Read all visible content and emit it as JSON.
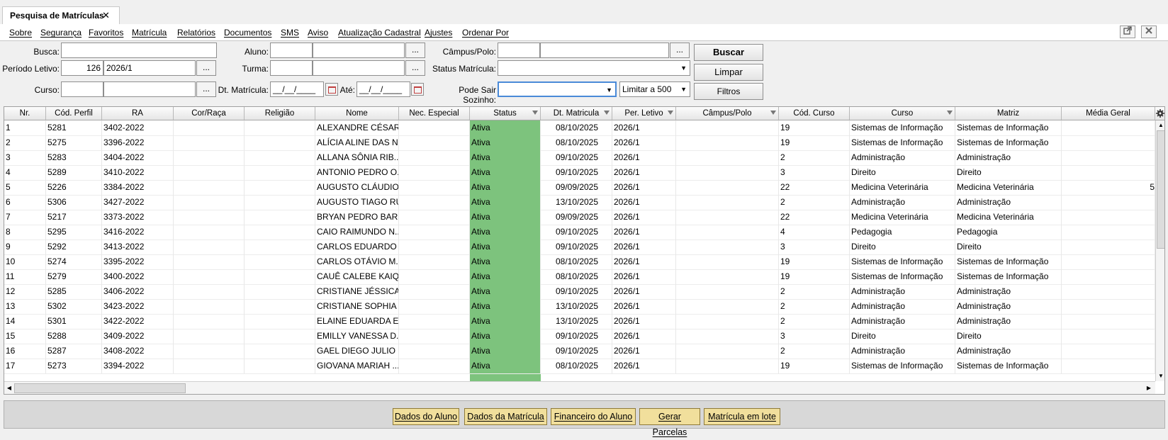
{
  "tab": {
    "title": "Pesquisa de Matrículas",
    "close": "✕"
  },
  "menu": [
    "Sobre",
    "Segurança",
    "Favoritos",
    "Matrícula",
    "Relatórios",
    "Documentos",
    "SMS",
    "Aviso",
    "Atualização Cadastral",
    "Ajustes",
    "Ordenar Por"
  ],
  "window_buttons": {
    "popout_icon": "popout-icon",
    "close_icon": "close-icon"
  },
  "filters": {
    "busca_label": "Busca:",
    "periodo_label": "Período Letivo:",
    "periodo_code": "126",
    "periodo_value": "2026/1",
    "curso_label": "Curso:",
    "aluno_label": "Aluno:",
    "turma_label": "Turma:",
    "dt_matricula_label": "Dt. Matrícula:",
    "dt_matricula_value": "__/__/____",
    "ate_label": "Até:",
    "ate_value": "__/__/____",
    "campus_label": "Câmpus/Polo:",
    "status_label": "Status Matrícula:",
    "pode_sair_label": "Pode Sair Sozinho:",
    "limit_value": "Limitar a 500",
    "ellipsis": "...",
    "caret": "▼"
  },
  "buttons": {
    "buscar": "Buscar",
    "limpar": "Limpar",
    "filtros": "Filtros"
  },
  "grid": {
    "columns": [
      "Nr.",
      "Cód. Perfil",
      "RA",
      "Cor/Raça",
      "Religião",
      "Nome",
      "Nec. Especial",
      "Status",
      "Dt. Matricula",
      "Per. Letivo",
      "Câmpus/Polo",
      "Cód. Curso",
      "Curso",
      "Matriz",
      "Média Geral"
    ],
    "settings_icon": "gear-icon",
    "rows": [
      [
        "1",
        "5281",
        "3402-2022",
        "",
        "",
        "ALEXANDRE CÉSAR ...",
        "",
        "Ativa",
        "08/10/2025",
        "2026/1",
        "",
        "19",
        "Sistemas de Informação",
        "Sistemas de Informação",
        ""
      ],
      [
        "2",
        "5275",
        "3396-2022",
        "",
        "",
        "ALÍCIA ALINE DAS N...",
        "",
        "Ativa",
        "08/10/2025",
        "2026/1",
        "",
        "19",
        "Sistemas de Informação",
        "Sistemas de Informação",
        ""
      ],
      [
        "3",
        "5283",
        "3404-2022",
        "",
        "",
        "ALLANA SÔNIA RIB...",
        "",
        "Ativa",
        "09/10/2025",
        "2026/1",
        "",
        "2",
        "Administração",
        "Administração",
        ""
      ],
      [
        "4",
        "5289",
        "3410-2022",
        "",
        "",
        "ANTONIO PEDRO O...",
        "",
        "Ativa",
        "09/10/2025",
        "2026/1",
        "",
        "3",
        "Direito",
        "Direito",
        ""
      ],
      [
        "5",
        "5226",
        "3384-2022",
        "",
        "",
        "AUGUSTO CLÁUDIO...",
        "",
        "Ativa",
        "09/09/2025",
        "2026/1",
        "",
        "22",
        "Medicina Veterinária",
        "Medicina Veterinária",
        "5"
      ],
      [
        "6",
        "5306",
        "3427-2022",
        "",
        "",
        "AUGUSTO TIAGO RU...",
        "",
        "Ativa",
        "13/10/2025",
        "2026/1",
        "",
        "2",
        "Administração",
        "Administração",
        ""
      ],
      [
        "7",
        "5217",
        "3373-2022",
        "",
        "",
        "BRYAN PEDRO BAR...",
        "",
        "Ativa",
        "09/09/2025",
        "2026/1",
        "",
        "22",
        "Medicina Veterinária",
        "Medicina Veterinária",
        ""
      ],
      [
        "8",
        "5295",
        "3416-2022",
        "",
        "",
        "CAIO RAIMUNDO N...",
        "",
        "Ativa",
        "09/10/2025",
        "2026/1",
        "",
        "4",
        "Pedagogia",
        "Pedagogia",
        ""
      ],
      [
        "9",
        "5292",
        "3413-2022",
        "",
        "",
        "CARLOS EDUARDO J...",
        "",
        "Ativa",
        "09/10/2025",
        "2026/1",
        "",
        "3",
        "Direito",
        "Direito",
        ""
      ],
      [
        "10",
        "5274",
        "3395-2022",
        "",
        "",
        "CARLOS OTÁVIO M...",
        "",
        "Ativa",
        "08/10/2025",
        "2026/1",
        "",
        "19",
        "Sistemas de Informação",
        "Sistemas de Informação",
        ""
      ],
      [
        "11",
        "5279",
        "3400-2022",
        "",
        "",
        "CAUÊ CALEBE KAIQ...",
        "",
        "Ativa",
        "08/10/2025",
        "2026/1",
        "",
        "19",
        "Sistemas de Informação",
        "Sistemas de Informação",
        ""
      ],
      [
        "12",
        "5285",
        "3406-2022",
        "",
        "",
        "CRISTIANE JÉSSICA ...",
        "",
        "Ativa",
        "09/10/2025",
        "2026/1",
        "",
        "2",
        "Administração",
        "Administração",
        ""
      ],
      [
        "13",
        "5302",
        "3423-2022",
        "",
        "",
        "CRISTIANE SOPHIA ...",
        "",
        "Ativa",
        "13/10/2025",
        "2026/1",
        "",
        "2",
        "Administração",
        "Administração",
        ""
      ],
      [
        "14",
        "5301",
        "3422-2022",
        "",
        "",
        "ELAINE EDUARDA E...",
        "",
        "Ativa",
        "13/10/2025",
        "2026/1",
        "",
        "2",
        "Administração",
        "Administração",
        ""
      ],
      [
        "15",
        "5288",
        "3409-2022",
        "",
        "",
        "EMILLY VANESSA D...",
        "",
        "Ativa",
        "09/10/2025",
        "2026/1",
        "",
        "3",
        "Direito",
        "Direito",
        ""
      ],
      [
        "16",
        "5287",
        "3408-2022",
        "",
        "",
        "GAEL DIEGO JULIO ...",
        "",
        "Ativa",
        "09/10/2025",
        "2026/1",
        "",
        "2",
        "Administração",
        "Administração",
        ""
      ],
      [
        "17",
        "5273",
        "3394-2022",
        "",
        "",
        "GIOVANA MARIAH ...",
        "",
        "Ativa",
        "08/10/2025",
        "2026/1",
        "",
        "19",
        "Sistemas de Informação",
        "Sistemas de Informação",
        ""
      ]
    ]
  },
  "actions": [
    "Dados do Aluno",
    "Dados da Matrícula",
    "Financeiro do Aluno",
    "Gerar Parcelas",
    "Matrícula em lote"
  ],
  "colors": {
    "status_active": "#7dc37d",
    "action_button": "#f1df9c"
  }
}
